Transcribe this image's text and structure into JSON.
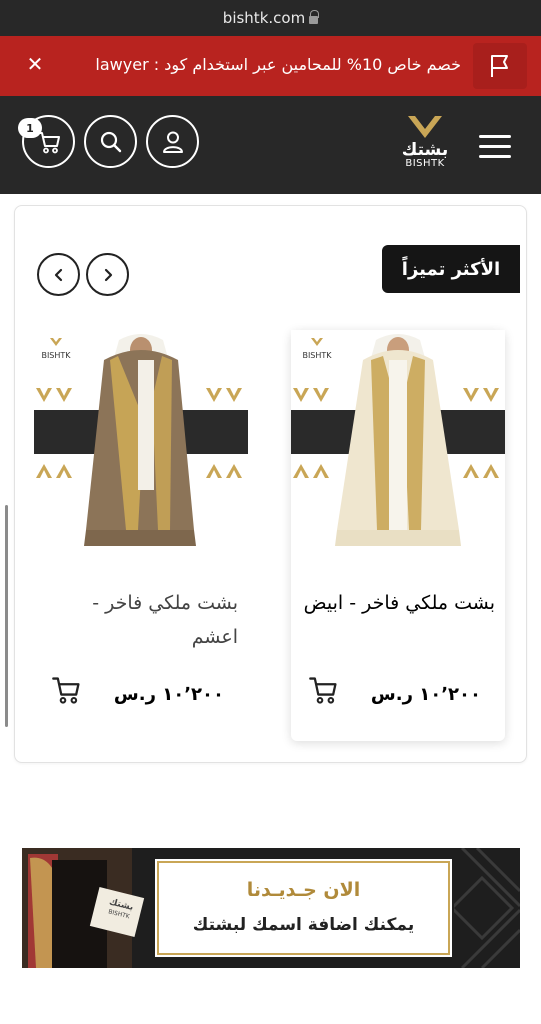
{
  "browser": {
    "url": "bishtk.com"
  },
  "promo": {
    "text": "خصم خاص 10% للمحامين عبر استخدام كود : lawyer",
    "close_icon": "close-icon",
    "flag_icon": "flag-icon",
    "background": "#b8231f"
  },
  "header": {
    "logo_ar": "بشتك",
    "logo_en": "BISHTK",
    "cart_count": "1",
    "icons": [
      "menu-icon",
      "user-icon",
      "search-icon",
      "cart-icon"
    ],
    "background": "#282828"
  },
  "section": {
    "title": "الأكثر تميزاً",
    "prev_icon": "chevron-left-icon",
    "next_icon": "chevron-right-icon"
  },
  "products": [
    {
      "name": "بشت ملكي فاخر - ابيض",
      "price": "١٠٬٢٠٠ ر.س",
      "color": "#efe6cf"
    },
    {
      "name": "بشت ملكي فاخر - اعشم",
      "price": "١٠٬٢٠٠ ر.س",
      "color": "#8c7458"
    }
  ],
  "banner": {
    "title": "الان جـديـدنا",
    "subtitle": "يمكنك اضافة اسمك لبشتك",
    "tag_ar": "بشتك",
    "tag_en": "BISHTK",
    "accent": "#c9a656"
  }
}
